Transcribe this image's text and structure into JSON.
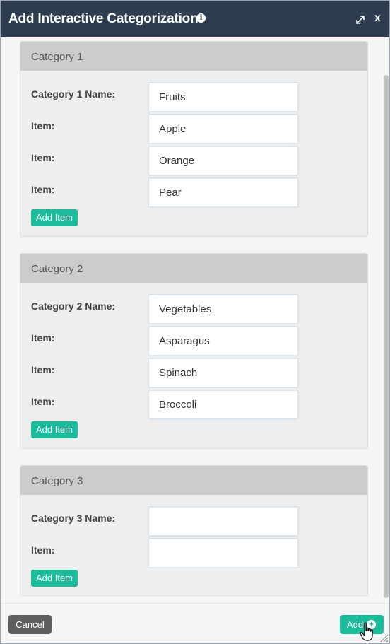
{
  "dialog": {
    "title": "Add Interactive Categorization",
    "info_icon": "info-icon",
    "expand_icon": "expand-icon",
    "close_label": "x"
  },
  "categories": [
    {
      "header": "Category 1",
      "name_label": "Category 1 Name:",
      "name_value": "Fruits",
      "items": [
        {
          "label": "Item:",
          "value": "Apple"
        },
        {
          "label": "Item:",
          "value": "Orange"
        },
        {
          "label": "Item:",
          "value": "Pear"
        }
      ],
      "add_item_label": "Add Item"
    },
    {
      "header": "Category 2",
      "name_label": "Category 2 Name:",
      "name_value": "Vegetables",
      "items": [
        {
          "label": "Item:",
          "value": "Asparagus"
        },
        {
          "label": "Item:",
          "value": "Spinach"
        },
        {
          "label": "Item:",
          "value": "Broccoli"
        }
      ],
      "add_item_label": "Add Item"
    },
    {
      "header": "Category 3",
      "name_label": "Category 3 Name:",
      "name_value": "",
      "items": [
        {
          "label": "Item:",
          "value": ""
        }
      ],
      "add_item_label": "Add Item"
    }
  ],
  "footer": {
    "cancel_label": "Cancel",
    "add_label": "Add"
  },
  "colors": {
    "titlebar": "#2e3e50",
    "accent": "#1abc9c",
    "cancel": "#5e5e5e"
  }
}
